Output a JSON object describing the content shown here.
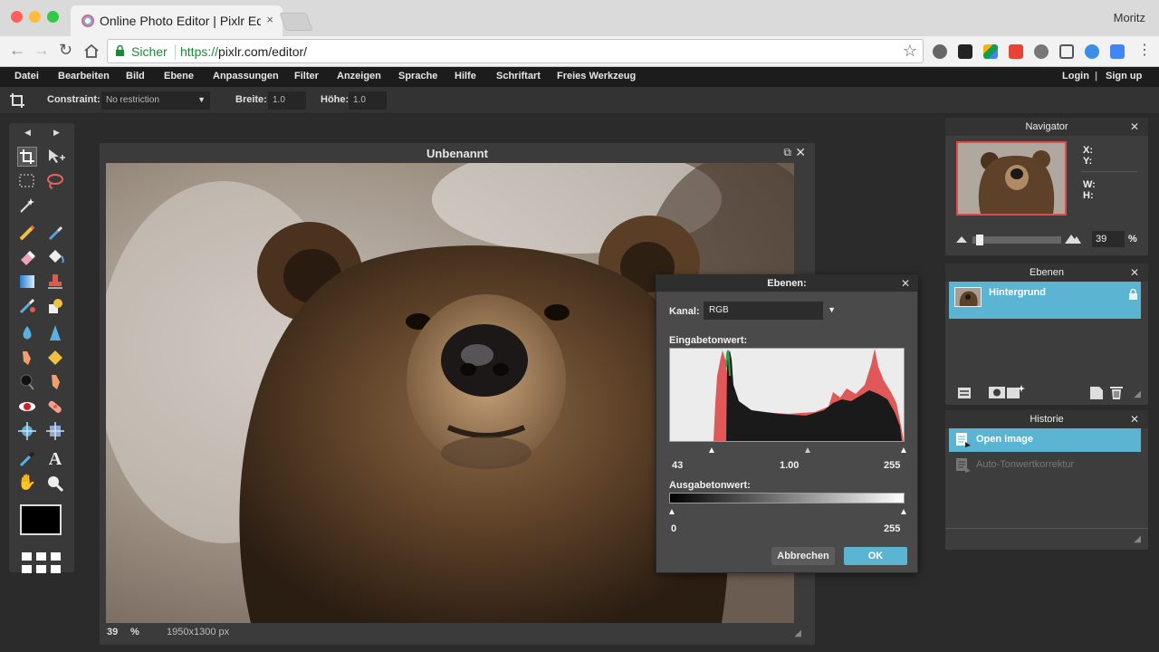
{
  "browser": {
    "tab_title": "Online Photo Editor | Pixlr Editor",
    "tab_close": "×",
    "profile_name": "Moritz",
    "secure_label": "Sicher",
    "url_proto": "https://",
    "url_rest": "pixlr.com/editor/"
  },
  "menu": {
    "items": [
      "Datei",
      "Bearbeiten",
      "Bild",
      "Ebene",
      "Anpassungen",
      "Filter",
      "Anzeigen",
      "Sprache",
      "Hilfe",
      "Schriftart",
      "Freies Werkzeug"
    ],
    "login": "Login",
    "divider": "|",
    "signup": "Sign up"
  },
  "options": {
    "constraint_label": "Constraint:",
    "constraint_value": "No restriction",
    "width_label": "Breite:",
    "width_value": "1.0",
    "height_label": "Höhe:",
    "height_value": "1.0"
  },
  "image_window": {
    "title": "Unbenannt",
    "zoom": "39",
    "zoom_unit": "%",
    "dimensions": "1950x1300 px"
  },
  "levels": {
    "title": "Ebenen:",
    "channel_label": "Kanal:",
    "channel_value": "RGB",
    "input_label": "Eingabetonwert:",
    "input_black": "43",
    "input_gamma": "1.00",
    "input_white": "255",
    "output_label": "Ausgabetonwert:",
    "output_black": "0",
    "output_white": "255",
    "cancel": "Abbrechen",
    "ok": "OK"
  },
  "navigator": {
    "title": "Navigator",
    "x_label": "X:",
    "y_label": "Y:",
    "w_label": "W:",
    "h_label": "H:",
    "zoom_value": "39",
    "zoom_unit": "%",
    "zoom_fraction": 0.04
  },
  "layers": {
    "title": "Ebenen",
    "items": [
      {
        "name": "Hintergrund",
        "locked": true
      }
    ]
  },
  "history": {
    "title": "Historie",
    "items": [
      "Open image",
      "Auto-Tonwertkorrektur"
    ]
  },
  "colors": {
    "accent": "#5ab4d2",
    "secure_green": "#1a8a3a",
    "menubar": "#1c1c1c"
  }
}
